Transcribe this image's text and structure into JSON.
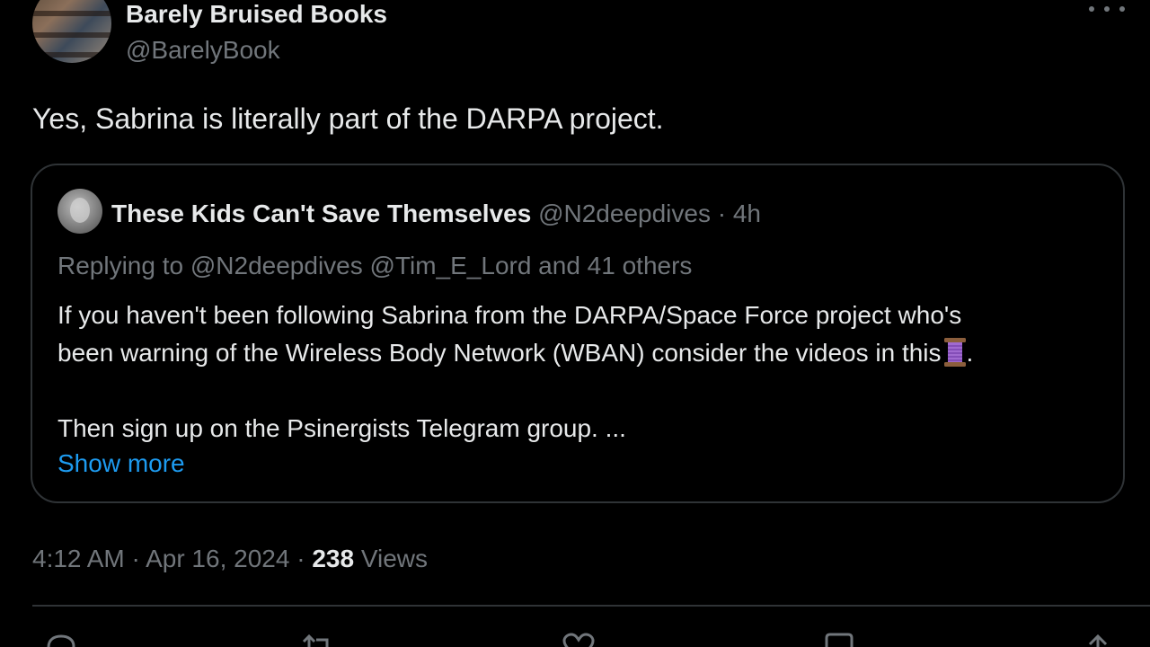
{
  "author": {
    "name": "Barely Bruised Books",
    "handle": "@BarelyBook"
  },
  "tweet": {
    "text": "Yes, Sabrina is literally part of the DARPA project."
  },
  "quoted": {
    "name": "These Kids Can't Save Themselves",
    "handle": "@N2deepdives",
    "separator": "·",
    "time": "4h",
    "reply_line": "Replying to @N2deepdives @Tim_E_Lord and 41 others",
    "body_line1": "If you haven't been following Sabrina from the DARPA/Space Force project who's",
    "body_line2": "been warning of the Wireless Body Network (WBAN) consider the videos in this",
    "body_line2_end": ".",
    "body_line3": "Then sign up on the Psinergists Telegram group. ...",
    "show_more": "Show more"
  },
  "meta": {
    "time": "4:12 AM",
    "separator": "·",
    "date": "Apr 16, 2024",
    "views_count": "238",
    "views_label": "Views"
  },
  "icons": {
    "more": "more-icon",
    "thread": "spool-icon",
    "reply": "reply-icon",
    "retweet": "retweet-icon",
    "like": "heart-icon",
    "bookmark": "bookmark-icon",
    "share": "share-icon"
  },
  "colors": {
    "background": "#000000",
    "text": "#e7e9ea",
    "muted": "#71767b",
    "link": "#1d9bf0",
    "border": "#2f3336"
  }
}
